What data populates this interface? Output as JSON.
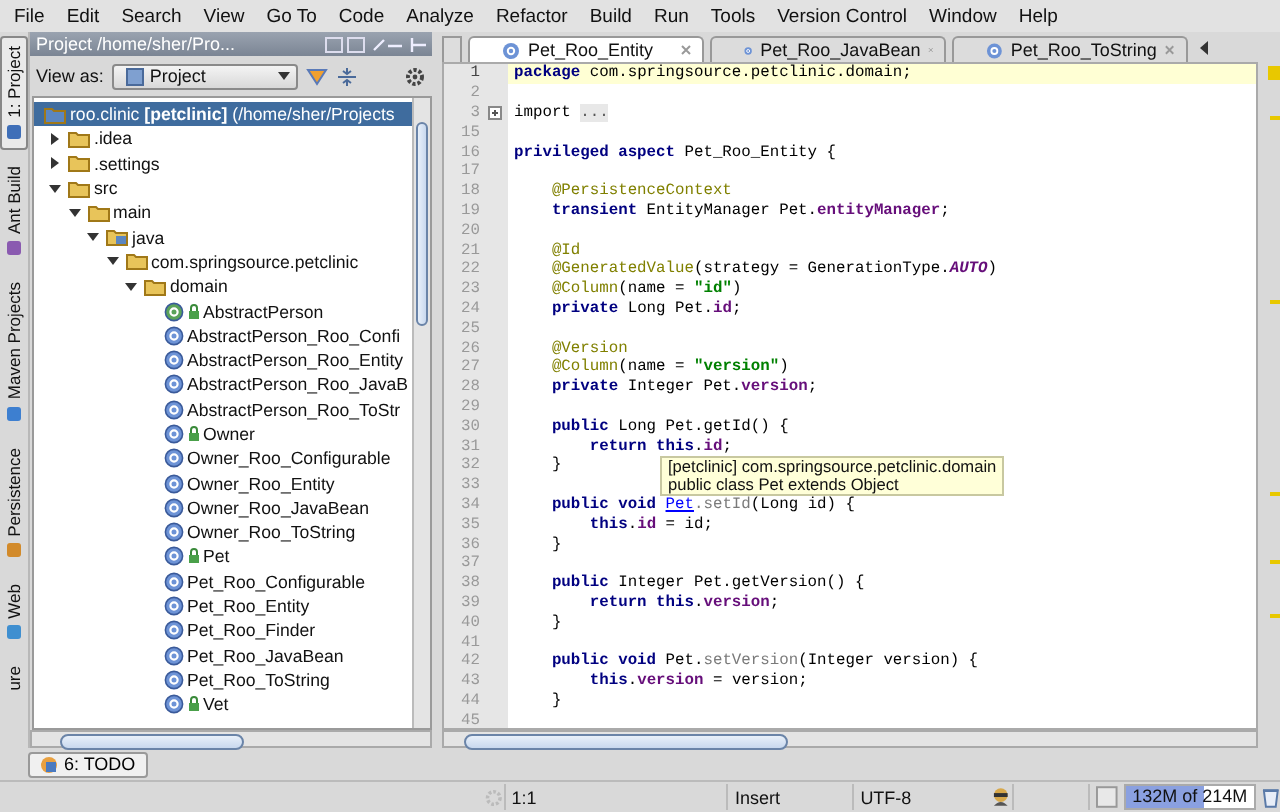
{
  "menu": [
    "File",
    "Edit",
    "Search",
    "View",
    "Go To",
    "Code",
    "Analyze",
    "Refactor",
    "Build",
    "Run",
    "Tools",
    "Version Control",
    "Window",
    "Help"
  ],
  "tool_strip": [
    {
      "label": "1: Project",
      "kind": "project",
      "selected": true
    },
    {
      "label": "Ant Build",
      "kind": "ant",
      "selected": false
    },
    {
      "label": "Maven Projects",
      "kind": "maven",
      "selected": false
    },
    {
      "label": "Persistence",
      "kind": "persistence",
      "selected": false
    },
    {
      "label": "Web",
      "kind": "web",
      "selected": false
    },
    {
      "label": "ure",
      "kind": "none",
      "selected": false
    }
  ],
  "project": {
    "title": "Project /home/sher/Pro...",
    "view_as_label": "View as:",
    "view_as_value": "Project",
    "tree": [
      {
        "label": "roo.clinic **[petclinic]** (/home/sher/Projects",
        "kind": "module",
        "selected": true,
        "children": [
          {
            "label": ".idea",
            "kind": "folder",
            "selected": false,
            "expanded": false
          },
          {
            "label": ".settings",
            "kind": "folder",
            "selected": false,
            "expanded": false
          },
          {
            "label": "src",
            "kind": "folder",
            "selected": false,
            "expanded": true,
            "children": [
              {
                "label": "main",
                "kind": "folder",
                "selected": false,
                "expanded": true,
                "children": [
                  {
                    "label": "java",
                    "kind": "source-folder",
                    "selected": false,
                    "expanded": true,
                    "children": [
                      {
                        "label": "com.springsource.petclinic",
                        "kind": "package",
                        "selected": false,
                        "expanded": true,
                        "children": [
                          {
                            "label": "domain",
                            "kind": "folder",
                            "selected": false,
                            "expanded": true,
                            "children": [
                              {
                                "label": "AbstractPerson",
                                "kind": "abstract-class",
                                "selected": false
                              },
                              {
                                "label": "AbstractPerson_Roo_Confi",
                                "kind": "aspect",
                                "selected": false
                              },
                              {
                                "label": "AbstractPerson_Roo_Entity",
                                "kind": "aspect",
                                "selected": false
                              },
                              {
                                "label": "AbstractPerson_Roo_JavaB",
                                "kind": "aspect",
                                "selected": false
                              },
                              {
                                "label": "AbstractPerson_Roo_ToStr",
                                "kind": "aspect",
                                "selected": false
                              },
                              {
                                "label": "Owner",
                                "kind": "class",
                                "selected": false
                              },
                              {
                                "label": "Owner_Roo_Configurable",
                                "kind": "aspect",
                                "selected": false
                              },
                              {
                                "label": "Owner_Roo_Entity",
                                "kind": "aspect",
                                "selected": false
                              },
                              {
                                "label": "Owner_Roo_JavaBean",
                                "kind": "aspect",
                                "selected": false
                              },
                              {
                                "label": "Owner_Roo_ToString",
                                "kind": "aspect",
                                "selected": false
                              },
                              {
                                "label": "Pet",
                                "kind": "class",
                                "selected": false
                              },
                              {
                                "label": "Pet_Roo_Configurable",
                                "kind": "aspect",
                                "selected": false
                              },
                              {
                                "label": "Pet_Roo_Entity",
                                "kind": "aspect",
                                "selected": false
                              },
                              {
                                "label": "Pet_Roo_Finder",
                                "kind": "aspect",
                                "selected": false
                              },
                              {
                                "label": "Pet_Roo_JavaBean",
                                "kind": "aspect",
                                "selected": false
                              },
                              {
                                "label": "Pet_Roo_ToString",
                                "kind": "aspect",
                                "selected": false
                              },
                              {
                                "label": "Vet",
                                "kind": "class",
                                "selected": false
                              }
                            ]
                          }
                        ]
                      }
                    ]
                  }
                ]
              }
            ]
          }
        ]
      }
    ]
  },
  "editor": {
    "tabs": [
      {
        "label": "Pet_Roo_Entity",
        "selected": true
      },
      {
        "label": "Pet_Roo_JavaBean",
        "selected": false
      },
      {
        "label": "Pet_Roo_ToString",
        "selected": false
      }
    ],
    "lines": [
      {
        "num": "1",
        "current": true,
        "tokens": [
          {
            "t": "package",
            "kind": "keyword"
          },
          {
            "t": " com.springsource.petclinic.domain;",
            "kind": "plain"
          }
        ]
      },
      {
        "num": "2",
        "current": false
      },
      {
        "num": "3",
        "current": false,
        "folded": true,
        "tokens": [
          {
            "t": "import ",
            "kind": "plain"
          },
          {
            "t": "...",
            "kind": "folded"
          }
        ]
      },
      {
        "num": "15",
        "current": false
      },
      {
        "num": "16",
        "current": false,
        "tokens": [
          {
            "t": "privileged aspect",
            "kind": "keyword"
          },
          {
            "t": " Pet_Roo_Entity {",
            "kind": "plain"
          }
        ]
      },
      {
        "num": "17",
        "current": false
      },
      {
        "num": "18",
        "current": false,
        "tokens": [
          {
            "t": "    @PersistenceContext",
            "kind": "annotation"
          }
        ]
      },
      {
        "num": "19",
        "current": false,
        "tokens": [
          {
            "t": "    transient",
            "kind": "keyword"
          },
          {
            "t": " EntityManager Pet.",
            "kind": "plain"
          },
          {
            "t": "entityManager",
            "kind": "field"
          },
          {
            "t": ";",
            "kind": "plain"
          }
        ]
      },
      {
        "num": "20",
        "current": false
      },
      {
        "num": "21",
        "current": false,
        "tokens": [
          {
            "t": "    @Id",
            "kind": "annotation"
          }
        ]
      },
      {
        "num": "22",
        "current": false,
        "tokens": [
          {
            "t": "    @GeneratedValue",
            "kind": "annotation"
          },
          {
            "t": "(strategy = GenerationType.",
            "kind": "plain"
          },
          {
            "t": "AUTO",
            "kind": "constant"
          },
          {
            "t": ")",
            "kind": "plain"
          }
        ]
      },
      {
        "num": "23",
        "current": false,
        "tokens": [
          {
            "t": "    @Column",
            "kind": "annotation"
          },
          {
            "t": "(name = ",
            "kind": "plain"
          },
          {
            "t": "\"id\"",
            "kind": "string"
          },
          {
            "t": ")",
            "kind": "plain"
          }
        ]
      },
      {
        "num": "24",
        "current": false,
        "tokens": [
          {
            "t": "    private",
            "kind": "keyword"
          },
          {
            "t": " Long Pet.",
            "kind": "plain"
          },
          {
            "t": "id",
            "kind": "field"
          },
          {
            "t": ";",
            "kind": "plain"
          }
        ]
      },
      {
        "num": "25",
        "current": false
      },
      {
        "num": "26",
        "current": false,
        "tokens": [
          {
            "t": "    @Version",
            "kind": "annotation"
          }
        ]
      },
      {
        "num": "27",
        "current": false,
        "tokens": [
          {
            "t": "    @Column",
            "kind": "annotation"
          },
          {
            "t": "(name = ",
            "kind": "plain"
          },
          {
            "t": "\"version\"",
            "kind": "string"
          },
          {
            "t": ")",
            "kind": "plain"
          }
        ]
      },
      {
        "num": "28",
        "current": false,
        "tokens": [
          {
            "t": "    private",
            "kind": "keyword"
          },
          {
            "t": " Integer Pet.",
            "kind": "plain"
          },
          {
            "t": "version",
            "kind": "field"
          },
          {
            "t": ";",
            "kind": "plain"
          }
        ]
      },
      {
        "num": "29",
        "current": false
      },
      {
        "num": "30",
        "current": false,
        "tokens": [
          {
            "t": "    public",
            "kind": "keyword"
          },
          {
            "t": " Long Pet.getId() {",
            "kind": "plain"
          }
        ]
      },
      {
        "num": "31",
        "current": false,
        "tokens": [
          {
            "t": "        return this",
            "kind": "keyword"
          },
          {
            "t": ".",
            "kind": "plain"
          },
          {
            "t": "id",
            "kind": "field"
          },
          {
            "t": ";",
            "kind": "plain"
          }
        ]
      },
      {
        "num": "32",
        "current": false,
        "tokens": [
          {
            "t": "    }",
            "kind": "plain"
          }
        ]
      },
      {
        "num": "33",
        "current": false
      },
      {
        "num": "34",
        "current": false,
        "tokens": [
          {
            "t": "    public void ",
            "kind": "keyword"
          },
          {
            "t": "Pet",
            "kind": "link"
          },
          {
            "t": ".setId",
            "kind": "muted"
          },
          {
            "t": "(Long id) {",
            "kind": "plain"
          }
        ]
      },
      {
        "num": "35",
        "current": false,
        "tokens": [
          {
            "t": "        this",
            "kind": "keyword"
          },
          {
            "t": ".",
            "kind": "plain"
          },
          {
            "t": "id",
            "kind": "field"
          },
          {
            "t": " = id;",
            "kind": "plain"
          }
        ]
      },
      {
        "num": "36",
        "current": false,
        "tokens": [
          {
            "t": "    }",
            "kind": "plain"
          }
        ]
      },
      {
        "num": "37",
        "current": false
      },
      {
        "num": "38",
        "current": false,
        "tokens": [
          {
            "t": "    public",
            "kind": "keyword"
          },
          {
            "t": " Integer Pet.getVersion() {",
            "kind": "plain"
          }
        ]
      },
      {
        "num": "39",
        "current": false,
        "tokens": [
          {
            "t": "        return this",
            "kind": "keyword"
          },
          {
            "t": ".",
            "kind": "plain"
          },
          {
            "t": "version",
            "kind": "field"
          },
          {
            "t": ";",
            "kind": "plain"
          }
        ]
      },
      {
        "num": "40",
        "current": false,
        "tokens": [
          {
            "t": "    }",
            "kind": "plain"
          }
        ]
      },
      {
        "num": "41",
        "current": false
      },
      {
        "num": "42",
        "current": false,
        "tokens": [
          {
            "t": "    public void",
            "kind": "keyword"
          },
          {
            "t": " Pet.",
            "kind": "plain"
          },
          {
            "t": "setVersion",
            "kind": "muted"
          },
          {
            "t": "(Integer version) {",
            "kind": "plain"
          }
        ]
      },
      {
        "num": "43",
        "current": false,
        "tokens": [
          {
            "t": "        this",
            "kind": "keyword"
          },
          {
            "t": ".",
            "kind": "plain"
          },
          {
            "t": "version",
            "kind": "field"
          },
          {
            "t": " = version;",
            "kind": "plain"
          }
        ]
      },
      {
        "num": "44",
        "current": false,
        "tokens": [
          {
            "t": "    }",
            "kind": "plain"
          }
        ]
      },
      {
        "num": "45",
        "current": false
      }
    ],
    "tooltip": {
      "line_1": "[petclinic] com.springsource.petclinic.domain",
      "line_2": "public class Pet extends Object"
    }
  },
  "todo_button": "6: TODO",
  "status_bar": {
    "position": "1:1",
    "mode": "Insert",
    "encoding": "UTF-8",
    "memory": {
      "text": "132M of 214M",
      "level": 0.617
    }
  }
}
